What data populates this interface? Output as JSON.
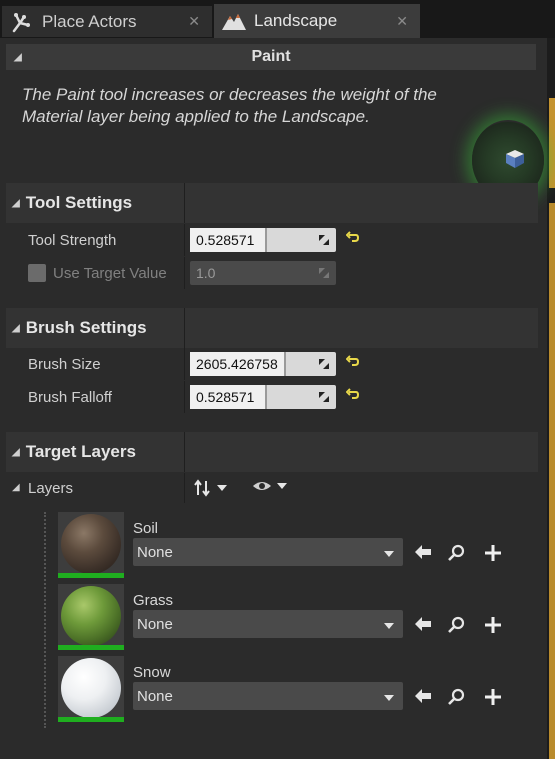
{
  "tabs": [
    {
      "label": "Place Actors",
      "icon": "place-actors-icon",
      "active": false
    },
    {
      "label": "Landscape",
      "icon": "landscape-icon",
      "active": true
    }
  ],
  "paint": {
    "header": "Paint",
    "description": "The Paint tool increases or decreases the weight of the Material layer being applied to the Landscape."
  },
  "tool_settings": {
    "title": "Tool Settings",
    "tool_strength": {
      "label": "Tool Strength",
      "value": "0.528571",
      "fraction": 0.528571
    },
    "use_target_value": {
      "label": "Use Target Value",
      "value": "1.0",
      "checked": false,
      "enabled": false
    }
  },
  "brush_settings": {
    "title": "Brush Settings",
    "brush_size": {
      "label": "Brush Size",
      "value": "2605.426758",
      "fraction": 0.66
    },
    "brush_falloff": {
      "label": "Brush Falloff",
      "value": "0.528571",
      "fraction": 0.528571
    }
  },
  "target_layers": {
    "title": "Target Layers",
    "layers_label": "Layers",
    "layers": [
      {
        "name": "Soil",
        "value": "None",
        "material": "soil"
      },
      {
        "name": "Grass",
        "value": "None",
        "material": "grass"
      },
      {
        "name": "Snow",
        "value": "None",
        "material": "snow"
      }
    ]
  },
  "colors": {
    "accent_green": "#1fae1f",
    "reset_yellow": "#e8d84a",
    "gold": "#c4932f"
  }
}
